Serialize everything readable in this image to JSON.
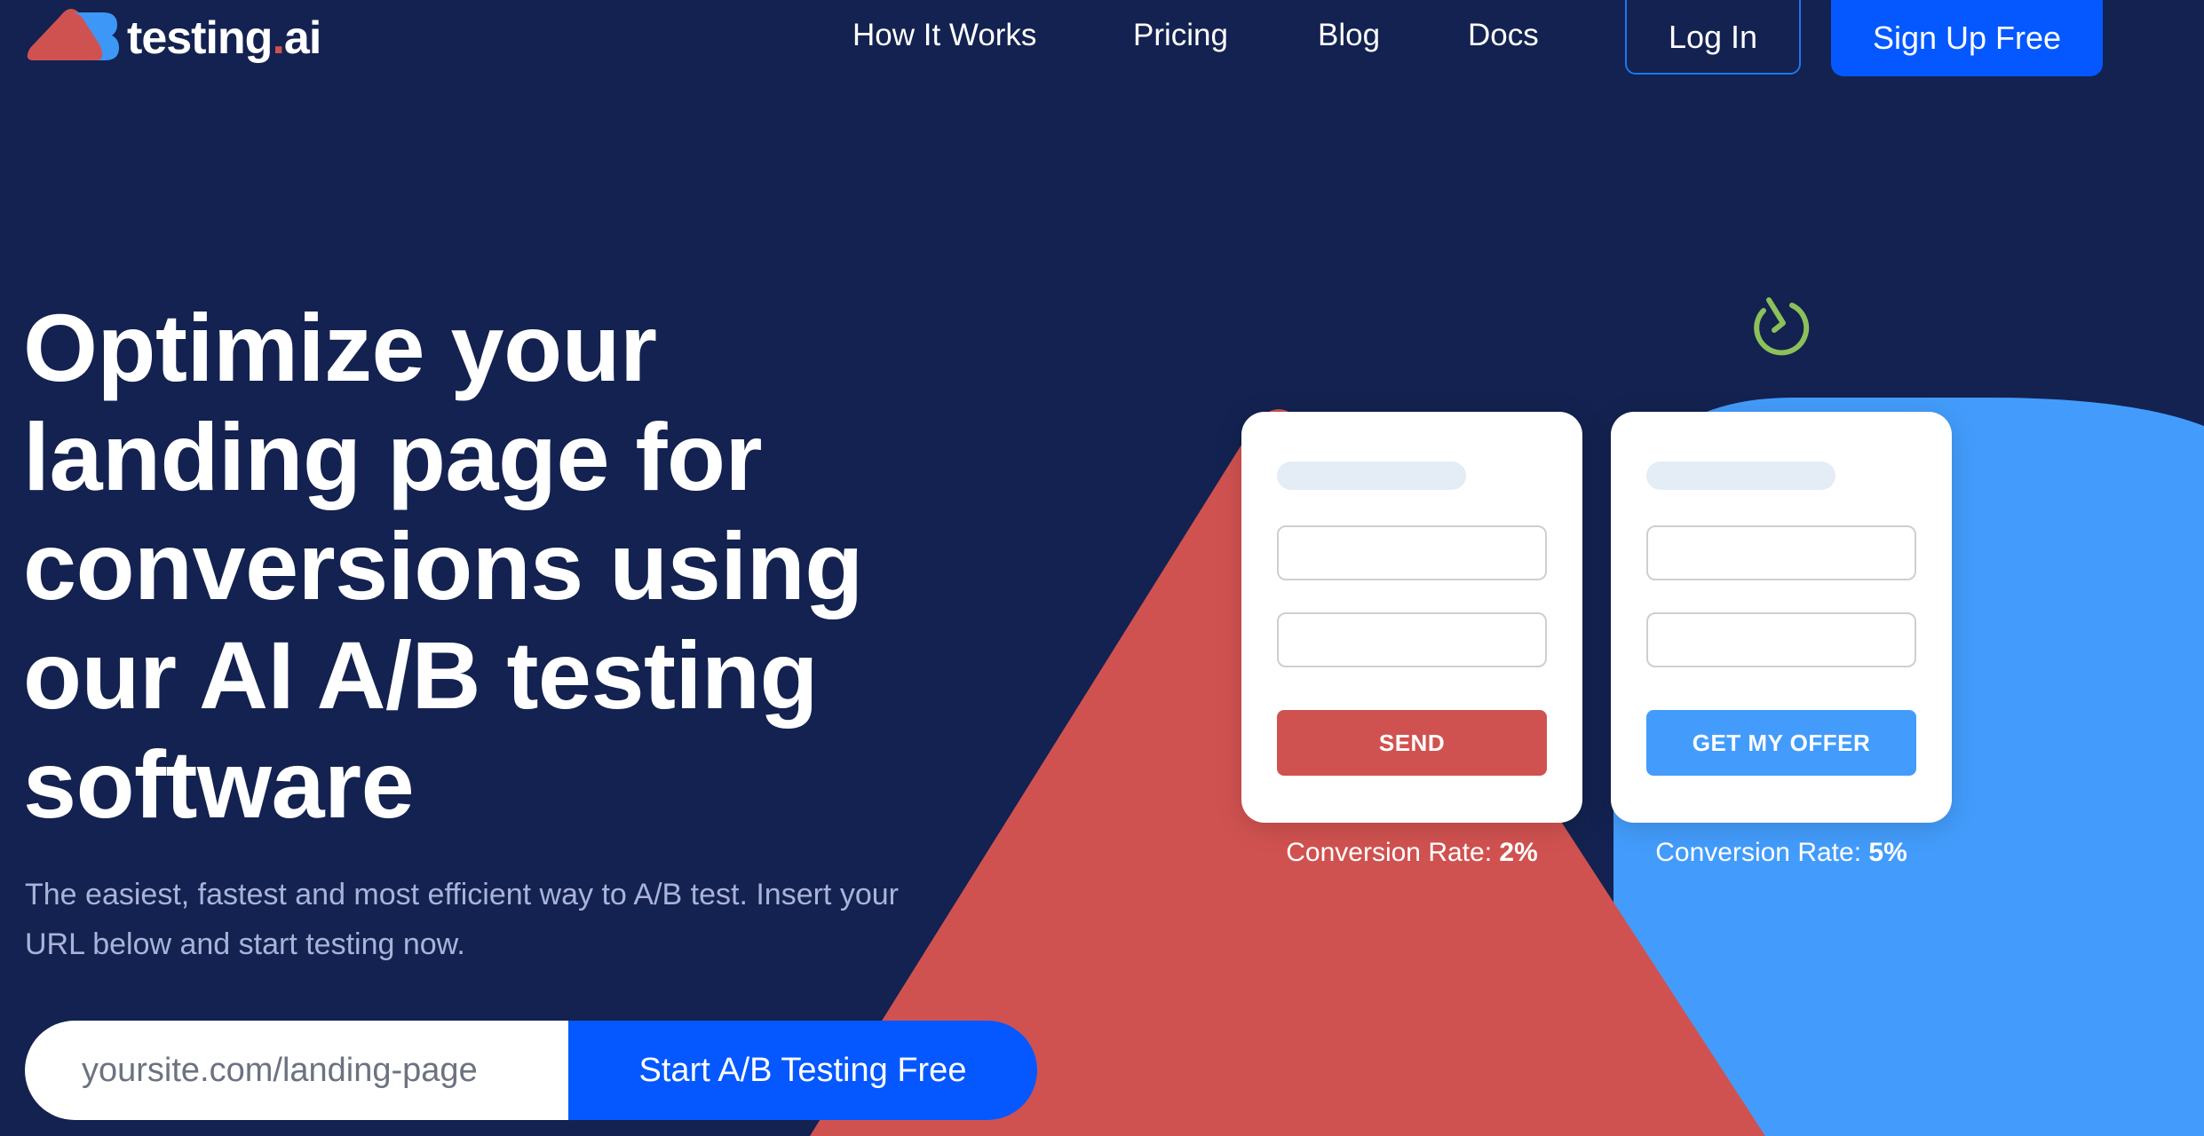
{
  "brand": {
    "logo_icon": "ab-logo-icon",
    "name_main": "testing",
    "name_dot": ".",
    "name_suffix": "ai"
  },
  "nav": {
    "links": [
      {
        "label": "How It Works"
      },
      {
        "label": "Pricing"
      },
      {
        "label": "Blog"
      },
      {
        "label": "Docs"
      }
    ],
    "login_label": "Log In",
    "signup_label": "Sign Up Free"
  },
  "hero": {
    "headline": "Optimize your landing page for conversions using our AI A/B testing software",
    "subtext": "The easiest, fastest and most efficient way to A/B test. Insert your URL below and start testing now.",
    "url_input": {
      "value": "",
      "placeholder": "yoursite.com/landing-page"
    },
    "submit_label": "Start A/B Testing Free"
  },
  "illustration": {
    "timer_icon": "timer-icon",
    "variant_a": {
      "button_label": "SEND",
      "rate_label": "Conversion Rate:",
      "rate_value": "2%",
      "color": "#d05250"
    },
    "variant_b": {
      "button_label": "GET MY OFFER",
      "rate_label": "Conversion Rate:",
      "rate_value": "5%",
      "color": "#439cfb"
    }
  },
  "colors": {
    "background": "#132250",
    "primary_blue": "#0558ff",
    "accent_red": "#d05250",
    "accent_light_blue": "#439cfb",
    "timer_green": "#8cc05a"
  }
}
